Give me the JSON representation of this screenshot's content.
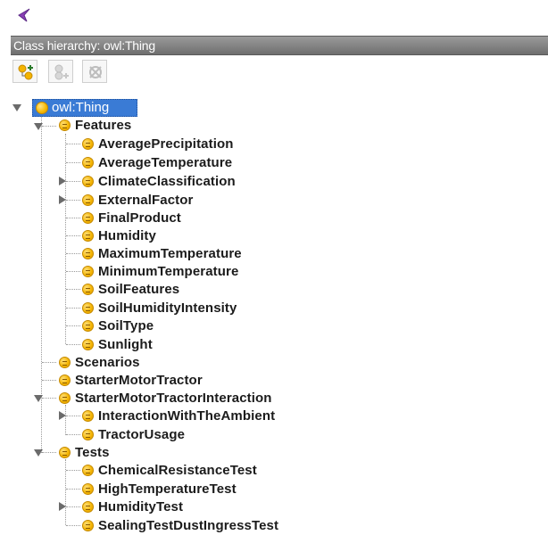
{
  "header": {
    "title": "Class hierarchy: owl:Thing"
  },
  "toolbar": {
    "buttons": [
      {
        "name": "add-subclass",
        "icon": "add-subclass-icon"
      },
      {
        "name": "add-sibling",
        "icon": "add-sibling-icon"
      },
      {
        "name": "delete-class",
        "icon": "delete-class-icon"
      }
    ]
  },
  "tree": {
    "root": "owl:Thing",
    "features": "Features",
    "average_precipitation": "AveragePrecipitation",
    "average_temperature": "AverageTemperature",
    "climate_classification": "ClimateClassification",
    "external_factor": "ExternalFactor",
    "final_product": "FinalProduct",
    "humidity": "Humidity",
    "maximum_temperature": "MaximumTemperature",
    "minimum_temperature": "MinimumTemperature",
    "soil_features": "SoilFeatures",
    "soil_humidity_intensity": "SoilHumidityIntensity",
    "soil_type": "SoilType",
    "sunlight": "Sunlight",
    "scenarios": "Scenarios",
    "starter_motor_tractor": "StarterMotorTractor",
    "starter_motor_tractor_interaction": "StarterMotorTractorInteraction",
    "interaction_with_the_ambient": "InteractionWithTheAmbient",
    "tractor_usage": "TractorUsage",
    "tests": "Tests",
    "chemical_resistance_test": "ChemicalResistanceTest",
    "high_temperature_test": "HighTemperatureTest",
    "humidity_test": "HumidityTest",
    "sealing_test_dust_ingress_test": "SealingTestDustIngressTest"
  },
  "colors": {
    "selection": "#3a7bd5",
    "class_icon": "#f4b400",
    "header_bar": "#808080"
  }
}
